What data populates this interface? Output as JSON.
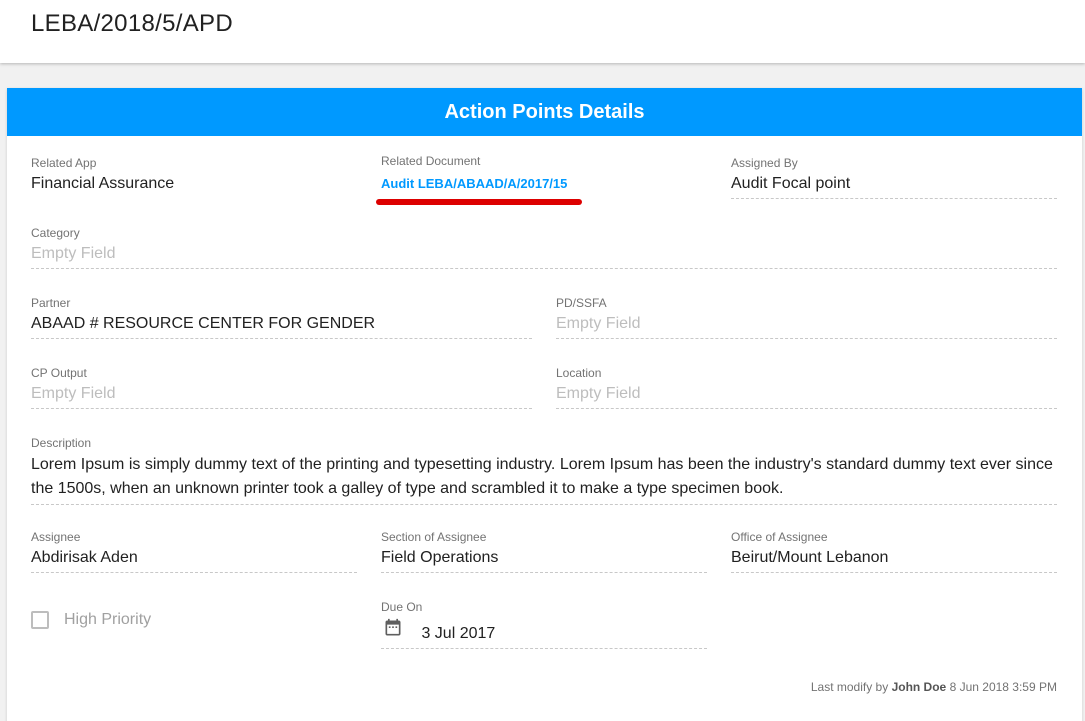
{
  "header": {
    "title": "LEBA/2018/5/APD"
  },
  "card": {
    "title": "Action Points Details"
  },
  "fields": {
    "related_app": {
      "label": "Related App",
      "value": "Financial Assurance"
    },
    "related_document": {
      "label": "Related Document",
      "value": "Audit LEBA/ABAAD/A/2017/15"
    },
    "assigned_by": {
      "label": "Assigned By",
      "value": "Audit Focal point"
    },
    "category": {
      "label": "Category",
      "value": "Empty Field"
    },
    "partner": {
      "label": "Partner",
      "value": "ABAAD # RESOURCE CENTER FOR GENDER"
    },
    "pd_ssfa": {
      "label": "PD/SSFA",
      "value": "Empty Field"
    },
    "cp_output": {
      "label": "CP Output",
      "value": "Empty Field"
    },
    "location": {
      "label": "Location",
      "value": "Empty Field"
    },
    "description": {
      "label": "Description",
      "value": "Lorem Ipsum is simply dummy text of the printing and typesetting industry. Lorem Ipsum has been the industry's standard dummy text ever since the 1500s, when an unknown printer took a galley of type and scrambled it to make a type specimen book."
    },
    "assignee": {
      "label": "Assignee",
      "value": "Abdirisak Aden"
    },
    "section_of_assignee": {
      "label": "Section of Assignee",
      "value": "Field Operations"
    },
    "office_of_assignee": {
      "label": "Office of Assignee",
      "value": "Beirut/Mount Lebanon"
    },
    "high_priority": {
      "label": "High Priority",
      "checked": false
    },
    "due_on": {
      "label": "Due On",
      "value": "3 Jul 2017",
      "icon": "calendar-icon"
    }
  },
  "footer": {
    "prefix": "Last modify by",
    "user": "John Doe",
    "timestamp": "8 Jun 2018 3:59 PM"
  },
  "colors": {
    "accent": "#0099ff",
    "annotation": "#dd0000"
  }
}
